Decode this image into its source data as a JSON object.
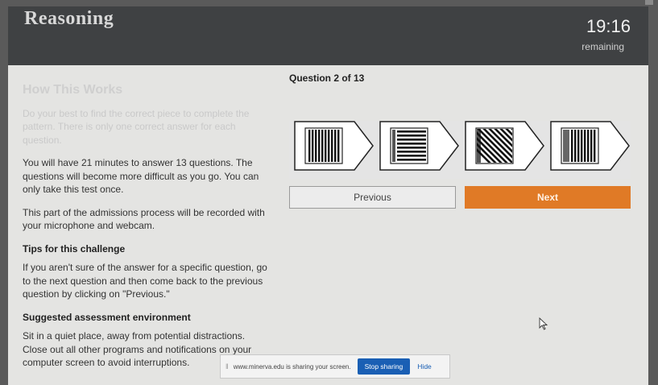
{
  "header": {
    "title": "Reasoning",
    "timer": "19:16",
    "timer_label": "remaining"
  },
  "info": {
    "heading": "How This Works",
    "intro": "Do your best to find the correct piece to complete the pattern. There is only one correct answer for each question.",
    "time_note": "You will have 21 minutes to answer 13 questions. The questions will become more difficult as you go. You can only take this test once.",
    "recording_note": "This part of the admissions process will be recorded with your microphone and webcam.",
    "tips_heading": "Tips for this challenge",
    "tips_text": "If you aren't sure of the answer for a specific question, go to the next question and then come back to the previous question by clicking on \"Previous.\"",
    "env_heading": "Suggested assessment environment",
    "env_text": "Sit in a quiet place, away from potential distractions. Close out all other programs and notifications on your computer screen to avoid interruptions."
  },
  "question": {
    "counter": "Question 2 of 13",
    "options": [
      {
        "icon": "vertical-stripes-icon"
      },
      {
        "icon": "horizontal-stripes-icon"
      },
      {
        "icon": "diagonal-stripes-icon"
      },
      {
        "icon": "vertical-stripes-fine-icon"
      }
    ]
  },
  "nav": {
    "previous_label": "Previous",
    "next_label": "Next"
  },
  "share_bar": {
    "text": "www.minerva.edu is sharing your screen.",
    "stop_label": "Stop sharing",
    "hide_label": "Hide"
  },
  "colors": {
    "header_bg": "#3f4143",
    "accent": "#e07a26",
    "share_button": "#1a5fb4"
  }
}
